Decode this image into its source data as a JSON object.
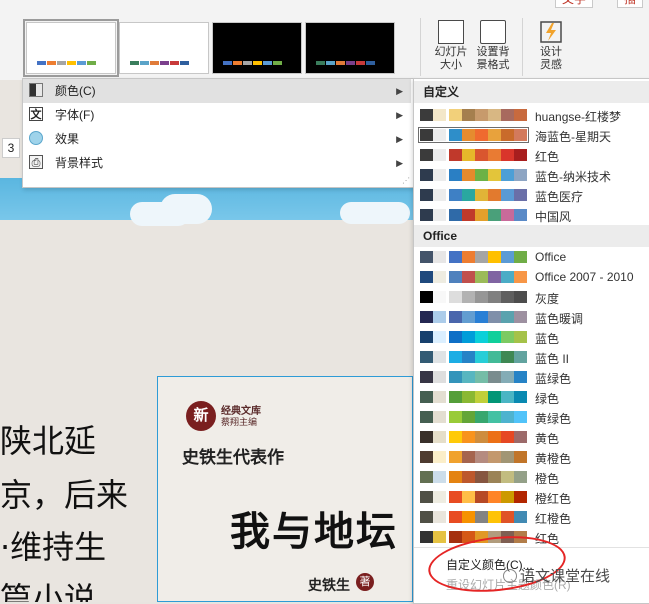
{
  "ribbon": {
    "top_buttons": [
      "文字",
      "插"
    ],
    "variants": [
      {
        "style": "light",
        "selected": true,
        "colors": [
          "#4472c4",
          "#ed7d31",
          "#a5a5a5",
          "#ffc000",
          "#5b9bd5",
          "#70ad47"
        ]
      },
      {
        "style": "light",
        "selected": false,
        "colors": [
          "#3a7d5c",
          "#5aa3c8",
          "#e07b39",
          "#7b3f8c",
          "#c83a3a",
          "#2f5f9e"
        ]
      },
      {
        "style": "dark",
        "selected": false,
        "colors": [
          "#4472c4",
          "#ed7d31",
          "#a5a5a5",
          "#ffc000",
          "#5b9bd5",
          "#70ad47"
        ]
      },
      {
        "style": "dark",
        "selected": false,
        "colors": [
          "#3a7d5c",
          "#5aa3c8",
          "#e07b39",
          "#7b3f8c",
          "#c83a3a",
          "#2f5f9e"
        ]
      }
    ],
    "slide_size": {
      "label_line1": "幻灯片",
      "label_line2": "大小"
    },
    "format_bg": {
      "label_line1": "设置背",
      "label_line2": "景格式"
    },
    "designer": {
      "label_line1": "设计",
      "label_line2": "灵感"
    }
  },
  "submenu": {
    "items": [
      {
        "label": "颜色(C)",
        "icon": "palette-icon",
        "highlighted": true
      },
      {
        "label": "字体(F)",
        "icon": "font-icon",
        "highlighted": false
      },
      {
        "label": "效果",
        "icon": "effects-icon",
        "highlighted": false
      },
      {
        "label": "背景样式",
        "icon": "background-icon",
        "highlighted": false
      }
    ]
  },
  "slide": {
    "ruler_number": "3",
    "body_lines": [
      "陕北延",
      "京，后来",
      "·维持生",
      "篇小说"
    ],
    "book": {
      "series_line1": "经典文库",
      "series_line2": "蔡翔主编",
      "seal_char": "新",
      "subtitle": "史铁生代表作",
      "title": "我与地坛",
      "author": "史铁生",
      "author_seal": "著"
    }
  },
  "panel": {
    "custom_header": "自定义",
    "office_header": "Office",
    "custom_themes": [
      {
        "name": "huangse-红楼梦",
        "selected": false,
        "colors": [
          "#3b3b3b",
          "#f3e7c9",
          "#f2d07a",
          "#a57f4e",
          "#c79a6c",
          "#d8b783",
          "#a86a5e",
          "#c86a3e"
        ]
      },
      {
        "name": "海蓝色-星期天",
        "selected": true,
        "colors": [
          "#3a3a3a",
          "#ececec",
          "#2e8ec9",
          "#e58b2f",
          "#ef6a2f",
          "#e8a23c",
          "#c96b2b",
          "#d37a5c"
        ]
      },
      {
        "name": "红色",
        "selected": false,
        "colors": [
          "#3b3b3b",
          "#ececec",
          "#c0392b",
          "#e6b82a",
          "#d9562f",
          "#e97b33",
          "#d9352b",
          "#a81e1e"
        ]
      },
      {
        "name": "蓝色-纳米技术",
        "selected": false,
        "colors": [
          "#2e3b4e",
          "#ececec",
          "#2a7fc4",
          "#e48a2c",
          "#6cb246",
          "#e3c53a",
          "#4d9fd6",
          "#8da5c3"
        ]
      },
      {
        "name": "蓝色医疗",
        "selected": false,
        "colors": [
          "#2e3b4e",
          "#ececec",
          "#3e80c5",
          "#2aa7a0",
          "#e1b437",
          "#e27a2e",
          "#5a9ad4",
          "#6a6fa8"
        ]
      },
      {
        "name": "中国风",
        "selected": false,
        "colors": [
          "#2e3b4e",
          "#ececec",
          "#2f6aa8",
          "#c03a2b",
          "#e3a02b",
          "#4aa07a",
          "#c86a9a",
          "#5a8ac7"
        ]
      }
    ],
    "office_themes": [
      {
        "name": "Office",
        "colors": [
          "#44546a",
          "#e7e6e6",
          "#4472c4",
          "#ed7d31",
          "#a5a5a5",
          "#ffc000",
          "#5b9bd5",
          "#70ad47"
        ]
      },
      {
        "name": "Office 2007 - 2010",
        "colors": [
          "#1f497d",
          "#eeece1",
          "#4f81bd",
          "#c0504d",
          "#9bbb59",
          "#8064a2",
          "#4bacc6",
          "#f79646"
        ]
      },
      {
        "name": "灰度",
        "colors": [
          "#000000",
          "#f8f8f8",
          "#dddddd",
          "#b2b2b2",
          "#969696",
          "#808080",
          "#5f5f5f",
          "#4d4d4d"
        ]
      },
      {
        "name": "蓝色暖调",
        "colors": [
          "#242852",
          "#acccea",
          "#4a66ac",
          "#629dd1",
          "#297fd5",
          "#7f8fa9",
          "#5aa2ae",
          "#9d90a0"
        ]
      },
      {
        "name": "蓝色",
        "colors": [
          "#17406d",
          "#dbefff",
          "#0f6fc6",
          "#009dd9",
          "#0bd0d9",
          "#10cf9b",
          "#7cca62",
          "#a5c249"
        ]
      },
      {
        "name": "蓝色 II",
        "colors": [
          "#335b74",
          "#dfe3e5",
          "#1cade4",
          "#2683c6",
          "#27ced7",
          "#42ba97",
          "#3e8853",
          "#62a39f"
        ]
      },
      {
        "name": "蓝绿色",
        "colors": [
          "#373545",
          "#dedede",
          "#3494ba",
          "#58b6c0",
          "#75bda7",
          "#7a8c8e",
          "#84acb6",
          "#2683c6"
        ]
      },
      {
        "name": "绿色",
        "colors": [
          "#455f51",
          "#e3ded1",
          "#549e39",
          "#8ab833",
          "#c0cf3a",
          "#029676",
          "#4ab5c4",
          "#0989b1"
        ]
      },
      {
        "name": "黄绿色",
        "colors": [
          "#455f51",
          "#e3ded1",
          "#99cb38",
          "#63a537",
          "#37a76f",
          "#44c1a3",
          "#4eb3cf",
          "#51c3f9"
        ]
      },
      {
        "name": "黄色",
        "colors": [
          "#39302a",
          "#e5dec9",
          "#ffca08",
          "#f8931d",
          "#ce8d3e",
          "#ec7016",
          "#e64823",
          "#9c6a6a"
        ]
      },
      {
        "name": "黄橙色",
        "colors": [
          "#4e3b30",
          "#fbeec9",
          "#f0a22e",
          "#a5644e",
          "#b58b80",
          "#c3986d",
          "#a19574",
          "#c17529"
        ]
      },
      {
        "name": "橙色",
        "colors": [
          "#637052",
          "#ccddea",
          "#e48312",
          "#bd582c",
          "#865640",
          "#9b8357",
          "#c2bc80",
          "#94a088"
        ]
      },
      {
        "name": "橙红色",
        "colors": [
          "#505046",
          "#eeece1",
          "#e84c22",
          "#ffbd47",
          "#b64926",
          "#ff8427",
          "#cc9900",
          "#b22600"
        ]
      },
      {
        "name": "红橙色",
        "colors": [
          "#505046",
          "#e9e5dc",
          "#e84c22",
          "#f69200",
          "#838383",
          "#fec306",
          "#df5327",
          "#418ab3"
        ]
      },
      {
        "name": "红色",
        "colors": [
          "#323232",
          "#e5c243",
          "#a5300f",
          "#d55816",
          "#e19825",
          "#b19c7d",
          "#7f5f52",
          "#b27d49"
        ]
      }
    ],
    "footer_custom": "自定义颜色(C)...",
    "footer_reset": "重设幻灯片主题颜色(R)"
  },
  "watermark": "语文课堂在线"
}
